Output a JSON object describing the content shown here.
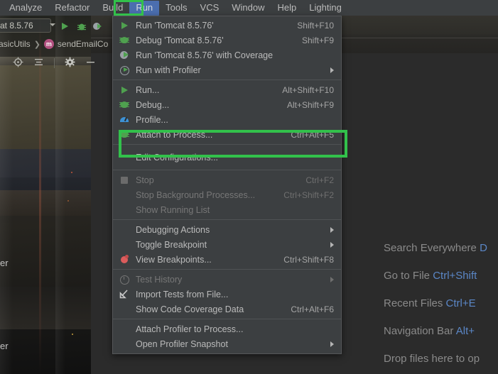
{
  "window": {
    "app": "IntelliJ IDEA"
  },
  "menubar": {
    "items": [
      {
        "label": "Analyze",
        "mnemonic": "z",
        "selected": false
      },
      {
        "label": "Refactor",
        "mnemonic": "R",
        "selected": false
      },
      {
        "label": "Build",
        "mnemonic": "B",
        "selected": false
      },
      {
        "label": "Run",
        "mnemonic": "u",
        "selected": true
      },
      {
        "label": "Tools",
        "mnemonic": "T",
        "selected": false
      },
      {
        "label": "VCS",
        "mnemonic": "S",
        "selected": false
      },
      {
        "label": "Window",
        "mnemonic": "W",
        "selected": false
      },
      {
        "label": "Help",
        "mnemonic": "H",
        "selected": false
      },
      {
        "label": "Lighting",
        "mnemonic": "",
        "selected": false
      }
    ]
  },
  "toolbar": {
    "run_config": "at 8.5.76",
    "run_config_full": "Tomcat 8.5.76",
    "icons": [
      "run-icon",
      "debug-icon",
      "coverage-icon"
    ]
  },
  "breadcrumb": {
    "items": [
      "BasicUtils",
      "sendEmailCo"
    ],
    "method_badge": "m"
  },
  "tool_window_toolbar": {
    "icons": [
      "locate-icon",
      "collapse-all-icon",
      "settings-gear-icon",
      "hide-icon"
    ]
  },
  "run_menu": {
    "title": "Run",
    "groups": [
      {
        "items": [
          {
            "label": "Run 'Tomcat 8.5.76'",
            "shortcut": "Shift+F10",
            "icon": "run-icon",
            "disabled": false,
            "submenu": false
          },
          {
            "label": "Debug 'Tomcat 8.5.76'",
            "shortcut": "Shift+F9",
            "icon": "debug-bug-icon",
            "disabled": false,
            "submenu": false
          },
          {
            "label": "Run 'Tomcat 8.5.76' with Coverage",
            "shortcut": "",
            "icon": "coverage-icon",
            "disabled": false,
            "submenu": false
          },
          {
            "label": "Run with Profiler",
            "shortcut": "",
            "icon": "profiler-icon",
            "disabled": false,
            "submenu": true
          }
        ]
      },
      {
        "items": [
          {
            "label": "Run...",
            "shortcut": "Alt+Shift+F10",
            "icon": "run-icon",
            "disabled": false,
            "submenu": false
          },
          {
            "label": "Debug...",
            "shortcut": "Alt+Shift+F9",
            "icon": "debug-bug-icon",
            "disabled": false,
            "submenu": false
          },
          {
            "label": "Profile...",
            "shortcut": "",
            "icon": "profile-gauge-icon",
            "disabled": false,
            "submenu": false
          },
          {
            "label": "Attach to Process...",
            "shortcut": "Ctrl+Alt+F5",
            "icon": "debug-bug-icon",
            "disabled": false,
            "submenu": false
          },
          {
            "label": "Edit Configurations...",
            "shortcut": "",
            "icon": "none",
            "disabled": false,
            "submenu": false,
            "highlighted": true
          }
        ]
      },
      {
        "items": [
          {
            "label": "Stop",
            "shortcut": "Ctrl+F2",
            "icon": "stop-icon",
            "disabled": true,
            "submenu": false
          },
          {
            "label": "Stop Background Processes...",
            "shortcut": "Ctrl+Shift+F2",
            "icon": "none",
            "disabled": true,
            "submenu": false
          },
          {
            "label": "Show Running List",
            "shortcut": "",
            "icon": "none",
            "disabled": true,
            "submenu": false
          }
        ]
      },
      {
        "items": [
          {
            "label": "Debugging Actions",
            "shortcut": "",
            "icon": "none",
            "disabled": false,
            "submenu": true
          },
          {
            "label": "Toggle Breakpoint",
            "shortcut": "",
            "icon": "none",
            "disabled": false,
            "submenu": true
          },
          {
            "label": "View Breakpoints...",
            "shortcut": "Ctrl+Shift+F8",
            "icon": "breakpoint-icon",
            "disabled": false,
            "submenu": false
          }
        ]
      },
      {
        "items": [
          {
            "label": "Test History",
            "shortcut": "",
            "icon": "clock-icon",
            "disabled": true,
            "submenu": true
          },
          {
            "label": "Import Tests from File...",
            "shortcut": "",
            "icon": "import-icon",
            "disabled": false,
            "submenu": false
          },
          {
            "label": "Show Code Coverage Data",
            "shortcut": "Ctrl+Alt+F6",
            "icon": "none",
            "disabled": false,
            "submenu": false
          }
        ]
      },
      {
        "items": [
          {
            "label": "Attach Profiler to Process...",
            "shortcut": "",
            "icon": "none",
            "disabled": false,
            "submenu": false
          },
          {
            "label": "Open Profiler Snapshot",
            "shortcut": "",
            "icon": "none",
            "disabled": false,
            "submenu": true
          }
        ]
      }
    ]
  },
  "annotations": {
    "run_menu_box": {
      "target": "Run",
      "color": "#32c14b"
    },
    "edit_configurations_box": {
      "target": "Edit Configurations...",
      "color": "#32c14b"
    }
  },
  "editor_hints": [
    {
      "label": "Search Everywhere",
      "shortcut": "D"
    },
    {
      "label": "Go to File",
      "shortcut": "Ctrl+Shift"
    },
    {
      "label": "Recent Files",
      "shortcut": "Ctrl+E"
    },
    {
      "label": "Navigation Bar",
      "shortcut": "Alt+"
    },
    {
      "label": "Drop files here to op",
      "shortcut": ""
    }
  ],
  "left_fragments": [
    {
      "text": "er"
    },
    {
      "text": "er"
    }
  ],
  "colors": {
    "menu_bg": "#3c3f41",
    "panel_bg": "#2b2b2b",
    "accent_green": "#32c14b",
    "selection_blue": "#4b6eaf",
    "shortcut_blue": "#5b87c7",
    "text": "#bbbbbb",
    "text_disabled": "#777777"
  }
}
